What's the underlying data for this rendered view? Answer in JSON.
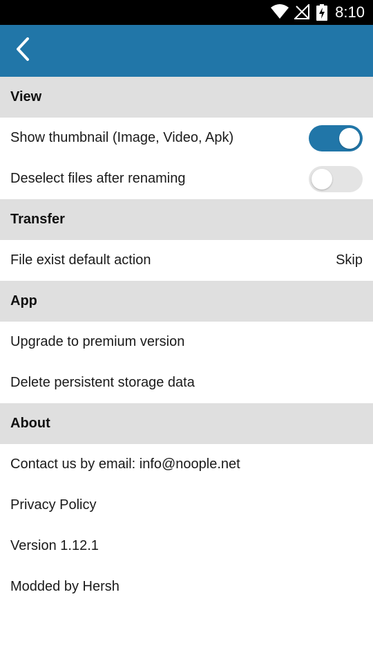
{
  "status_bar": {
    "time": "8:10",
    "icons": [
      "wifi-icon",
      "no-signal-icon",
      "battery-charging-icon"
    ]
  },
  "app_bar": {
    "back_icon": "chevron-left-icon",
    "color": "#2176a8"
  },
  "sections": {
    "view": {
      "title": "View",
      "show_thumbnail": {
        "label": "Show thumbnail (Image, Video, Apk)",
        "enabled": true
      },
      "deselect_files": {
        "label": "Deselect files after renaming",
        "enabled": false
      }
    },
    "transfer": {
      "title": "Transfer",
      "file_exist_action": {
        "label": "File exist default action",
        "value": "Skip"
      }
    },
    "app": {
      "title": "App",
      "upgrade": {
        "label": "Upgrade to premium version"
      },
      "delete_storage": {
        "label": "Delete persistent storage data"
      }
    },
    "about": {
      "title": "About",
      "contact": {
        "label": "Contact us by email: info@noople.net"
      },
      "privacy": {
        "label": "Privacy Policy"
      },
      "version": {
        "label": "Version 1.12.1"
      },
      "modded": {
        "label": "Modded by Hersh"
      }
    }
  }
}
